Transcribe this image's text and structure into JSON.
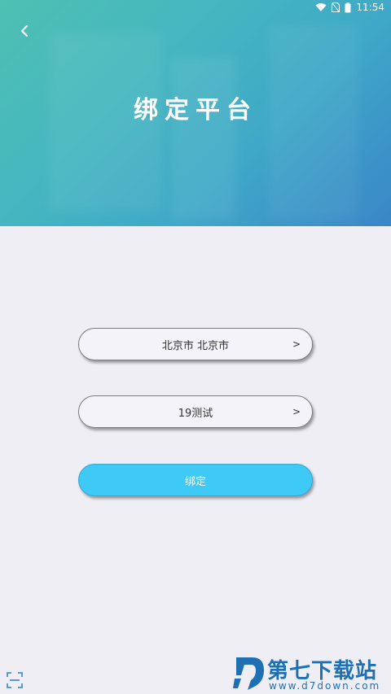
{
  "status_bar": {
    "time": "11:54",
    "icons": [
      "wifi-icon",
      "no-sim-icon",
      "battery-icon"
    ]
  },
  "header": {
    "back_icon": "chevron-left-icon",
    "title": "绑定平台"
  },
  "form": {
    "city_select": {
      "value": "北京市 北京市",
      "arrow": ">"
    },
    "platform_select": {
      "value": "19测试",
      "arrow": ">"
    },
    "bind_button": "绑定"
  },
  "footer": {
    "scan_icon": "scan-icon"
  },
  "watermark": {
    "title": "第七下载站",
    "url": "www.d7down.com"
  },
  "colors": {
    "header_gradient_start": "#4fc0b2",
    "header_gradient_end": "#3a86c8",
    "background": "#efeef5",
    "primary_button": "#3ec9f7",
    "watermark": "#1f6fb3"
  }
}
